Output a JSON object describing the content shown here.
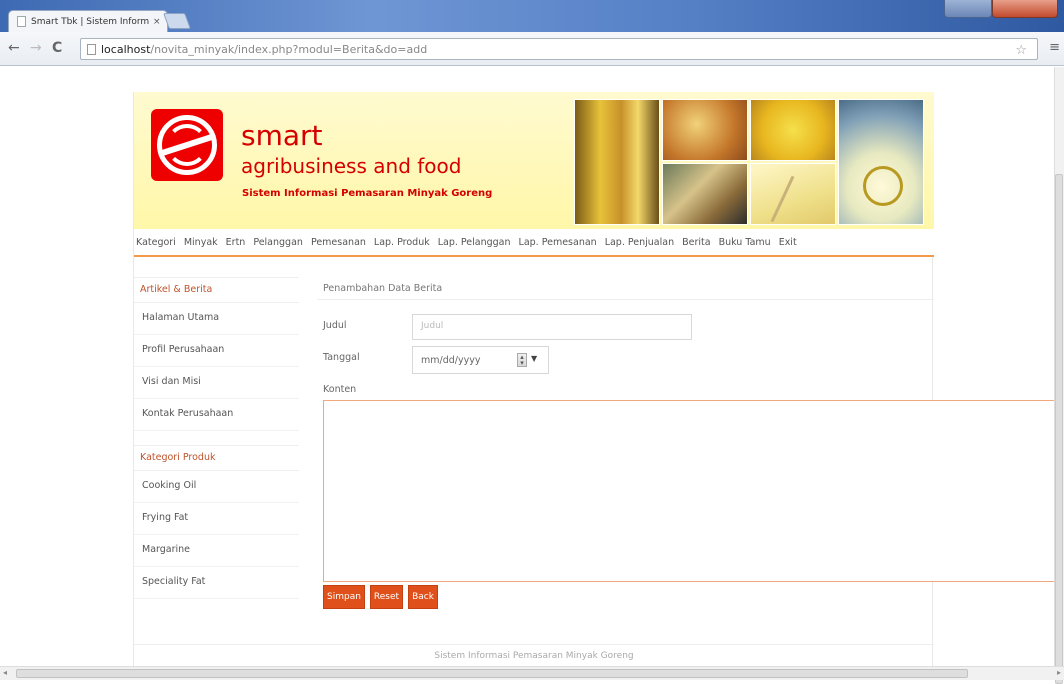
{
  "browser": {
    "tab_title": "Smart Tbk | Sistem Inform",
    "tab_close": "×",
    "url_host": "localhost",
    "url_path": "/novita_minyak/index.php?modul=Berita&do=add",
    "back": "←",
    "forward": "→",
    "reload": "C",
    "star": "☆",
    "menu": "≡"
  },
  "banner": {
    "brand": "smart",
    "sub": "agribusiness and food",
    "tagline": "Sistem Informasi Pemasaran Minyak Goreng"
  },
  "nav": [
    "Kategori",
    "Minyak",
    "Ertn",
    "Pelanggan",
    "Pemesanan",
    "Lap. Produk",
    "Lap. Pelanggan",
    "Lap. Pemesanan",
    "Lap. Penjualan",
    "Berita",
    "Buku Tamu",
    "Exit"
  ],
  "sidebar": {
    "section1": "Artikel & Berita",
    "items1": [
      "Halaman Utama",
      "Profil Perusahaan",
      "Visi dan Misi",
      "Kontak Perusahaan"
    ],
    "section2": "Kategori Produk",
    "items2": [
      "Cooking Oil",
      "Frying Fat",
      "Margarine",
      "Speciality Fat"
    ]
  },
  "form": {
    "title": "Penambahan Data Berita",
    "judul_label": "Judul",
    "judul_placeholder": "Judul",
    "tanggal_label": "Tanggal",
    "tanggal_value": "mm/dd/yyyy",
    "konten_label": "Konten",
    "buttons": [
      "Simpan",
      "Reset",
      "Back"
    ]
  },
  "footer": "Sistem Informasi Pemasaran Minyak Goreng",
  "colors": {
    "accent": "#e0501a",
    "brand_red": "#d50000",
    "banner_yellow": "#fff7a8"
  }
}
